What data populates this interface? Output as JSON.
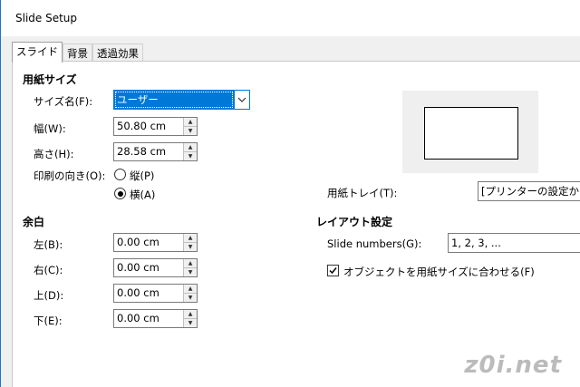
{
  "window": {
    "title": "Slide Setup"
  },
  "tabs": [
    "スライド",
    "背景",
    "透過効果"
  ],
  "paper": {
    "section": "用紙サイズ",
    "size_name_label": "サイズ名(F):",
    "size_name_value": "ユーザー",
    "width_label": "幅(W):",
    "width_value": "50.80 cm",
    "height_label": "高さ(H):",
    "height_value": "28.58 cm",
    "orientation_label": "印刷の向き(O):",
    "portrait_label": "縦(P)",
    "landscape_label": "横(A)",
    "orientation_selected": "landscape",
    "tray_label": "用紙トレイ(T):",
    "tray_value": "[プリンターの設定から]"
  },
  "margins": {
    "section": "余白",
    "left_label": "左(B):",
    "left_value": "0.00 cm",
    "right_label": "右(C):",
    "right_value": "0.00 cm",
    "top_label": "上(D):",
    "top_value": "0.00 cm",
    "bottom_label": "下(E):",
    "bottom_value": "0.00 cm"
  },
  "layout": {
    "section": "レイアウト設定",
    "slide_numbers_label": "Slide numbers(G):",
    "slide_numbers_value": "1, 2, 3, ...",
    "fit_label": "オブジェクトを用紙サイズに合わせる(F)",
    "fit_checked": true
  },
  "watermark": "z0i.net"
}
